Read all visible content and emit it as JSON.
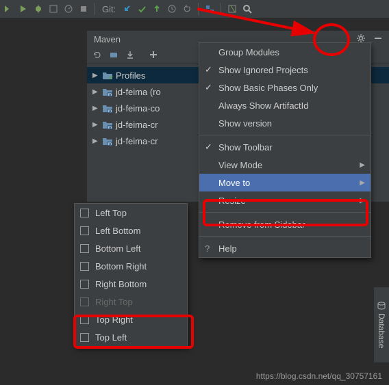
{
  "toolbar": {
    "git_label": "Git:"
  },
  "maven": {
    "title": "Maven",
    "tree": {
      "profiles": "Profiles",
      "items": [
        "jd-feima (ro",
        "jd-feima-co",
        "jd-feima-cr",
        "jd-feima-cr"
      ]
    }
  },
  "main_menu": {
    "items": [
      {
        "label": "Group Modules",
        "checked": false,
        "arrow": false
      },
      {
        "label": "Show Ignored Projects",
        "checked": true,
        "arrow": false
      },
      {
        "label": "Show Basic Phases Only",
        "checked": true,
        "arrow": false
      },
      {
        "label": "Always Show ArtifactId",
        "checked": false,
        "arrow": false
      },
      {
        "label": "Show version",
        "checked": false,
        "arrow": false
      }
    ],
    "group2": [
      {
        "label": "Show Toolbar",
        "checked": true,
        "arrow": false
      },
      {
        "label": "View Mode",
        "checked": false,
        "arrow": true
      },
      {
        "label": "Move to",
        "checked": false,
        "arrow": true,
        "highlight": true
      },
      {
        "label": "Resize",
        "checked": false,
        "arrow": true
      }
    ],
    "group3": [
      {
        "label": "Remove from Sidebar",
        "checked": false,
        "arrow": false
      }
    ],
    "group4": [
      {
        "label": "Help",
        "checked": false,
        "arrow": false,
        "help": true
      }
    ]
  },
  "sub_menu": {
    "items": [
      {
        "label": "Left Top"
      },
      {
        "label": "Left Bottom"
      },
      {
        "label": "Bottom Left"
      },
      {
        "label": "Bottom Right"
      },
      {
        "label": "Right Bottom"
      },
      {
        "label": "Right Top",
        "disabled": true
      },
      {
        "label": "Top Right"
      },
      {
        "label": "Top Left"
      }
    ]
  },
  "sidebar": {
    "database": "Database"
  },
  "watermark": "https://blog.csdn.net/qq_30757161"
}
